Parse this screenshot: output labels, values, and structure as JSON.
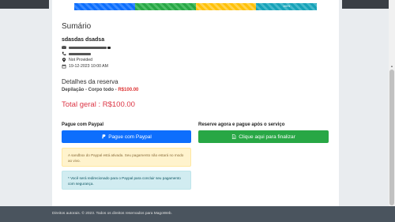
{
  "progress": {
    "last_label": "100%"
  },
  "summary": {
    "title": "Sumário",
    "client_name": "sdasdas dsadsa",
    "address": "Not Provided",
    "datetime": "19-12-2023 10:00 AM"
  },
  "details": {
    "title": "Detalhes da reserva",
    "service_name": "Depilação - Corpo todo - ",
    "service_price": "R$100.00",
    "total_label": "Total geral : R$100.00"
  },
  "payment": {
    "paypal_heading": "Pague com Paypal",
    "paypal_button": "Pague com Paypal",
    "reserve_heading": "Reserve agora e pague após o serviço",
    "finish_button": "Clique aqui para finalizar",
    "sandbox_alert": "A sandbox do Paypal está ativada. Seu pagamento não estará no modo ao vivo.",
    "redirect_alert": "* Você será redirecionado para o Paypal para concluir seu pagamento com segurança."
  },
  "footer": {
    "copyright": "Direitos autorais. © 2023. Todos os direitos reservados para MagoWeb."
  },
  "icons": [
    "envelope-icon",
    "phone-icon",
    "map-marker-icon",
    "calendar-icon",
    "paypal-icon",
    "file-icon"
  ]
}
